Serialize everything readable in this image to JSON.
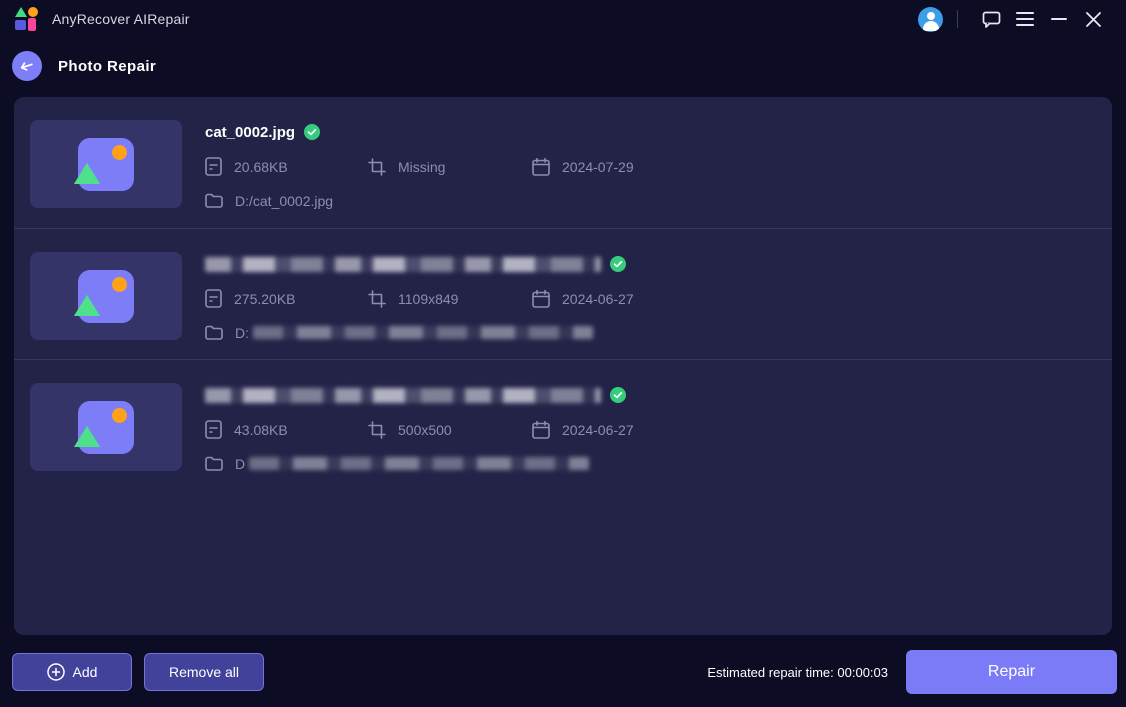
{
  "titlebar": {
    "app_title": "AnyRecover AIRepair"
  },
  "header": {
    "title": "Photo Repair"
  },
  "files": [
    {
      "name": "cat_0002.jpg",
      "name_redacted": false,
      "size": "20.68KB",
      "dimensions": "Missing",
      "date": "2024-07-29",
      "path": "D:/cat_0002.jpg",
      "path_redacted": false,
      "status": "repairable"
    },
    {
      "name": "",
      "name_redacted": true,
      "size": "275.20KB",
      "dimensions": "1109x849",
      "date": "2024-06-27",
      "path": "D:",
      "path_redacted": true,
      "status": "repairable"
    },
    {
      "name": "",
      "name_redacted": true,
      "size": "43.08KB",
      "dimensions": "500x500",
      "date": "2024-06-27",
      "path": "D",
      "path_redacted": true,
      "status": "repairable"
    }
  ],
  "footer": {
    "add_label": "Add",
    "remove_all_label": "Remove all",
    "estimate_text": "Estimated repair time: 00:00:03",
    "repair_label": "Repair"
  },
  "colors": {
    "background": "#0c0c24",
    "panel": "#232348",
    "accent": "#7b7bf8",
    "secondary_button": "#42429a",
    "success_badge": "#35cd7d",
    "thumb_square": "#7d7df7",
    "thumb_triangle": "#4ee08b",
    "thumb_circle": "#ffa217",
    "meta_text": "#8d8db0",
    "avatar_blue": "#3d9ee8"
  }
}
